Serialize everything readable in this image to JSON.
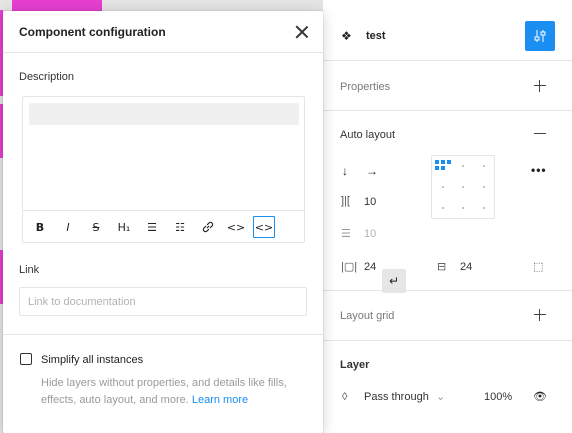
{
  "panel": {
    "component": {
      "icon": "component-icon",
      "name": "test",
      "action_icon": "tune-icon"
    },
    "properties": {
      "title": "Properties"
    },
    "auto_layout": {
      "title": "Auto layout",
      "direction_down": "↓",
      "direction_right": "→",
      "direction_wrap": "↵",
      "spacing_between": "10",
      "spacing_counter": "10",
      "padding_horizontal": "24",
      "padding_vertical": "24",
      "more_label": "•••"
    },
    "layout_grid": {
      "title": "Layout grid"
    },
    "layer": {
      "title": "Layer",
      "blend_mode": "Pass through",
      "opacity": "100%"
    }
  },
  "modal": {
    "title": "Component configuration",
    "description_label": "Description",
    "toolbar": {
      "bold": "B",
      "italic": "I",
      "strike": "S",
      "heading": "H₁",
      "bullets": "☰",
      "numbered": "☷",
      "link": "🔗",
      "code": "<>",
      "code_block": "<>"
    },
    "link_label": "Link",
    "link_placeholder": "Link to documentation",
    "simplify_label": "Simplify all instances",
    "simplify_help": "Hide layers without properties, and details like fills, effects, auto layout, and more.",
    "learn_more": "Learn more"
  },
  "colors": {
    "accent": "#1b8ef2",
    "canvas_pink": "#e63fd0"
  }
}
